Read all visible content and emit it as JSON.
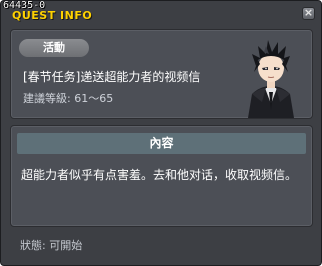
{
  "window": {
    "id_label": "64435-0",
    "title": "QUEST INFO",
    "close_glyph": "×"
  },
  "quest": {
    "tag": "活動",
    "name": "[春节任务]递送超能力者的视频信",
    "level": "建議等級: 61～65"
  },
  "content": {
    "header": "內容",
    "description": "超能力者似乎有点害羞。去和他对话，收取视频信。"
  },
  "status": {
    "text": "狀態: 可開始"
  },
  "icons": {
    "close": "close-icon",
    "portrait": "character-portrait"
  },
  "colors": {
    "window_bg": "#3d3f44",
    "panel_bg": "#4c4f56",
    "title": "#ffd200",
    "section_header": "#5e7078"
  }
}
